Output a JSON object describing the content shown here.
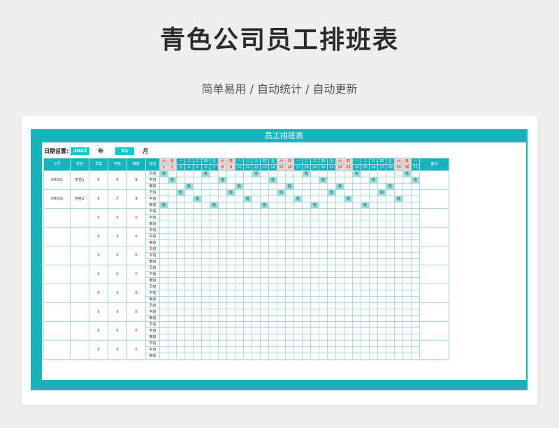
{
  "page": {
    "title": "青色公司员工排班表",
    "subtitle": "简单易用 / 自动统计 / 自动更新"
  },
  "sheet": {
    "banner": "员工排班表",
    "date_label": "日期设置:",
    "year": "2022",
    "year_unit": "年",
    "month": "01",
    "month_unit": "月",
    "headers": {
      "id": "工号",
      "name": "姓名",
      "early": "早班",
      "mid": "中班",
      "late": "晚班",
      "shift": "班次",
      "remark": "备注"
    },
    "weekdays": [
      "六",
      "日",
      "一",
      "二",
      "三",
      "四",
      "五",
      "六",
      "日",
      "一",
      "二",
      "三",
      "四",
      "五",
      "六",
      "日",
      "一",
      "二",
      "三",
      "四",
      "五",
      "六",
      "日",
      "一",
      "二",
      "三",
      "四",
      "五",
      "六",
      "日",
      "一"
    ],
    "days": [
      "1",
      "2",
      "3",
      "4",
      "5",
      "6",
      "7",
      "8",
      "9",
      "10",
      "11",
      "12",
      "13",
      "14",
      "15",
      "16",
      "17",
      "18",
      "19",
      "20",
      "21",
      "22",
      "23",
      "24",
      "25",
      "26",
      "27",
      "28",
      "29",
      "30",
      "31"
    ],
    "weekend_cols": [
      0,
      1,
      7,
      8,
      14,
      15,
      21,
      22,
      28,
      29
    ],
    "shift_names": [
      "早班",
      "中班",
      "晚班"
    ],
    "mark": "班",
    "employees": [
      {
        "id": "HH001",
        "name": "姓名1",
        "early": "8",
        "mid": "8",
        "late": "8",
        "rows": [
          [
            0,
            5,
            11,
            17,
            23,
            29
          ],
          [
            1,
            7,
            13,
            19,
            25,
            30
          ],
          [
            3,
            9,
            15,
            21,
            27
          ]
        ]
      },
      {
        "id": "HH002",
        "name": "姓名2",
        "early": "8",
        "mid": "7",
        "late": "8",
        "rows": [
          [
            2,
            8,
            14,
            20,
            26
          ],
          [
            4,
            10,
            16,
            22,
            28
          ],
          [
            0,
            6,
            12,
            18,
            24
          ]
        ]
      },
      {
        "id": "",
        "name": "",
        "early": "0",
        "mid": "0",
        "late": "0",
        "rows": [
          [],
          [],
          []
        ]
      },
      {
        "id": "",
        "name": "",
        "early": "0",
        "mid": "0",
        "late": "0",
        "rows": [
          [],
          [],
          []
        ]
      },
      {
        "id": "",
        "name": "",
        "early": "0",
        "mid": "0",
        "late": "0",
        "rows": [
          [],
          [],
          []
        ]
      },
      {
        "id": "",
        "name": "",
        "early": "0",
        "mid": "0",
        "late": "0",
        "rows": [
          [],
          [],
          []
        ]
      },
      {
        "id": "",
        "name": "",
        "early": "0",
        "mid": "0",
        "late": "0",
        "rows": [
          [],
          [],
          []
        ]
      },
      {
        "id": "",
        "name": "",
        "early": "0",
        "mid": "0",
        "late": "0",
        "rows": [
          [],
          [],
          []
        ]
      },
      {
        "id": "",
        "name": "",
        "early": "0",
        "mid": "0",
        "late": "0",
        "rows": [
          [],
          [],
          []
        ]
      },
      {
        "id": "",
        "name": "",
        "early": "0",
        "mid": "0",
        "late": "0",
        "rows": [
          [],
          [],
          []
        ]
      }
    ],
    "colors": {
      "accent": "#17b5bb",
      "weekend": "#f9cfcb",
      "mark": "#9be0e0"
    }
  }
}
